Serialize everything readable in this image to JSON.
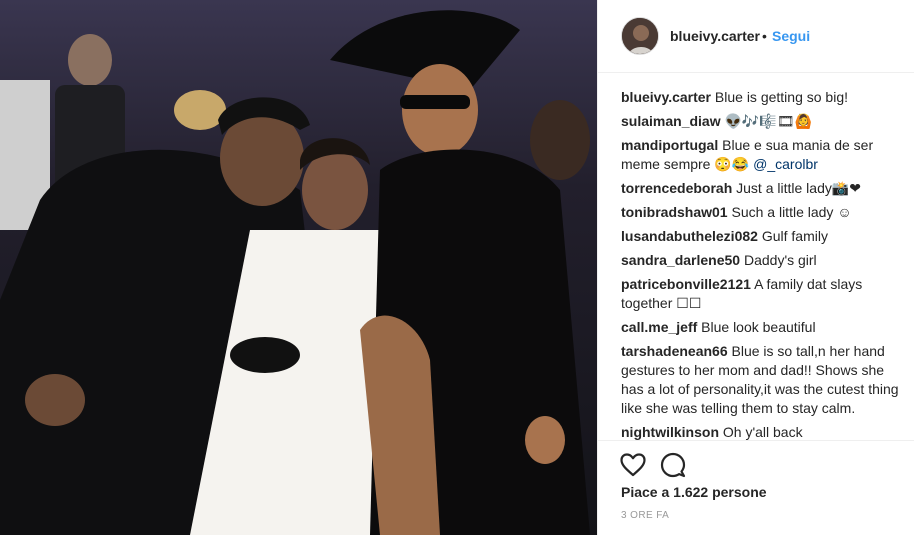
{
  "post": {
    "image_alt": "Photo of three people seated in an audience",
    "author": {
      "username": "blueivy.carter",
      "follow_label": "Segui",
      "separator": "•"
    },
    "caption": {
      "username": "blueivy.carter",
      "text": "Blue is getting so big!"
    },
    "comments": [
      {
        "username": "sulaiman_diaw",
        "text": "👽🎶🎼🎞🙆",
        "mention": ""
      },
      {
        "username": "mandiportugal",
        "text": "Blue e sua mania de ser meme sempre 😳😂 ",
        "mention": "@_carolbr"
      },
      {
        "username": "torrencedeborah",
        "text": "Just a little lady📸❤",
        "mention": ""
      },
      {
        "username": "tonibradshaw01",
        "text": "Such a little lady ☺",
        "mention": ""
      },
      {
        "username": "lusandabuthelezi082",
        "text": "Gulf family",
        "mention": ""
      },
      {
        "username": "sandra_darlene50",
        "text": "Daddy's girl",
        "mention": ""
      },
      {
        "username": "patricebonville2121",
        "text": "A family dat slays together ☐☐",
        "mention": ""
      },
      {
        "username": "call.me_jeff",
        "text": "Blue look beautiful",
        "mention": ""
      },
      {
        "username": "tarshadenean66",
        "text": "Blue is so tall,n her hand gestures to her mom and dad!! Shows she has a lot of personality,it was the cutest thing like she was telling them to stay calm.",
        "mention": ""
      },
      {
        "username": "nightwilkinson",
        "text": "Oh y'all back",
        "mention": ""
      }
    ],
    "likes_text": "Piace a 1.622 persone",
    "timestamp": "3 ORE FA"
  },
  "icons": {
    "like": "heart-icon",
    "comment": "comment-bubble-icon"
  },
  "colors": {
    "link_blue": "#3897f0",
    "mention_blue": "#003569",
    "text": "#262626",
    "muted": "#999999",
    "divider": "#efefef"
  }
}
